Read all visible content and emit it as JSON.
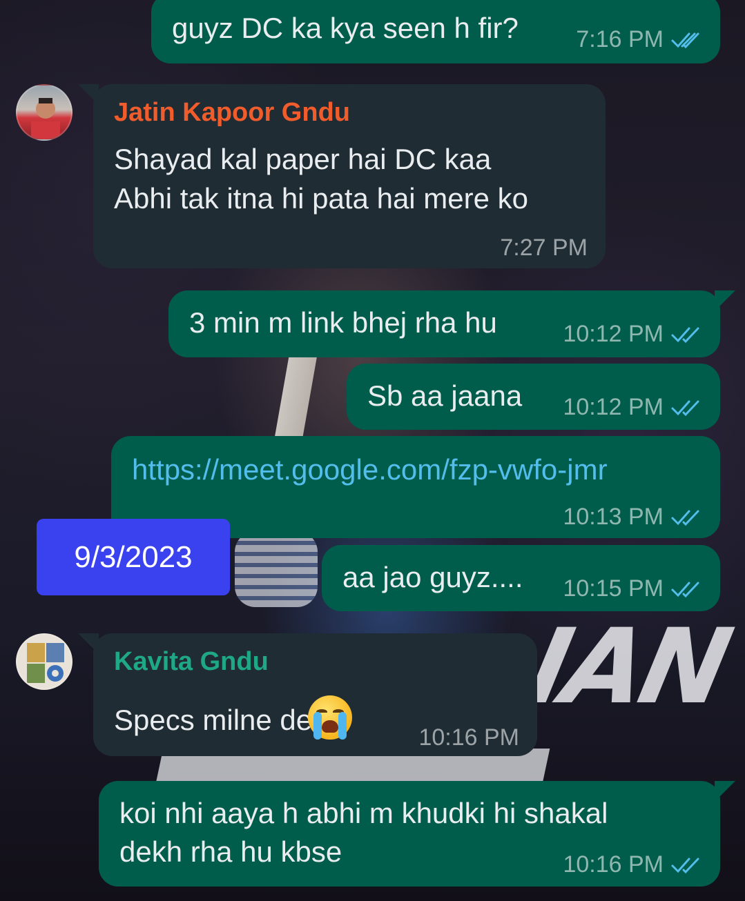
{
  "theme": {
    "outgoing_bubble": "#005d4b",
    "incoming_bubble": "#202c33",
    "read_tick": "#53bdeb",
    "date_chip": "#3a41ee"
  },
  "messages": [
    {
      "id": "m1",
      "direction": "outgoing",
      "text": "guyz DC ka kya seen h fir?",
      "time": "7:16 PM",
      "status": "read"
    },
    {
      "id": "m2",
      "direction": "incoming",
      "sender": "Jatin Kapoor Gndu",
      "sender_color": "#f15c2c",
      "lines": [
        "Shayad kal paper hai DC kaa",
        "Abhi tak itna hi pata hai mere ko"
      ],
      "time": "7:27 PM",
      "avatar": "selfie-avatar"
    },
    {
      "id": "m3",
      "direction": "outgoing",
      "text": "3 min m link bhej rha hu",
      "time": "10:12 PM",
      "status": "read"
    },
    {
      "id": "m4",
      "direction": "outgoing",
      "text": "Sb aa jaana",
      "time": "10:12 PM",
      "status": "read"
    },
    {
      "id": "m5",
      "direction": "outgoing",
      "text": "https://meet.google.com/fzp-vwfo-jmr",
      "time": "10:13 PM",
      "status": "read",
      "is_link": true
    },
    {
      "id": "m6",
      "direction": "outgoing",
      "text": "aa jao guyz....",
      "time": "10:15 PM",
      "status": "read"
    },
    {
      "id": "m7",
      "direction": "incoming",
      "sender": "Kavita Gndu",
      "sender_color": "#1fa885",
      "text": "Specs milne de",
      "emoji": "loudly-crying-face",
      "time": "10:16 PM",
      "avatar": "collage-avatar"
    },
    {
      "id": "m8",
      "direction": "outgoing",
      "lines": [
        "koi nhi aaya h abhi m khudki hi shakal",
        "dekh rha hu kbse"
      ],
      "time": "10:16 PM",
      "status": "read"
    }
  ],
  "date_chip": {
    "text": "9/3/2023"
  }
}
